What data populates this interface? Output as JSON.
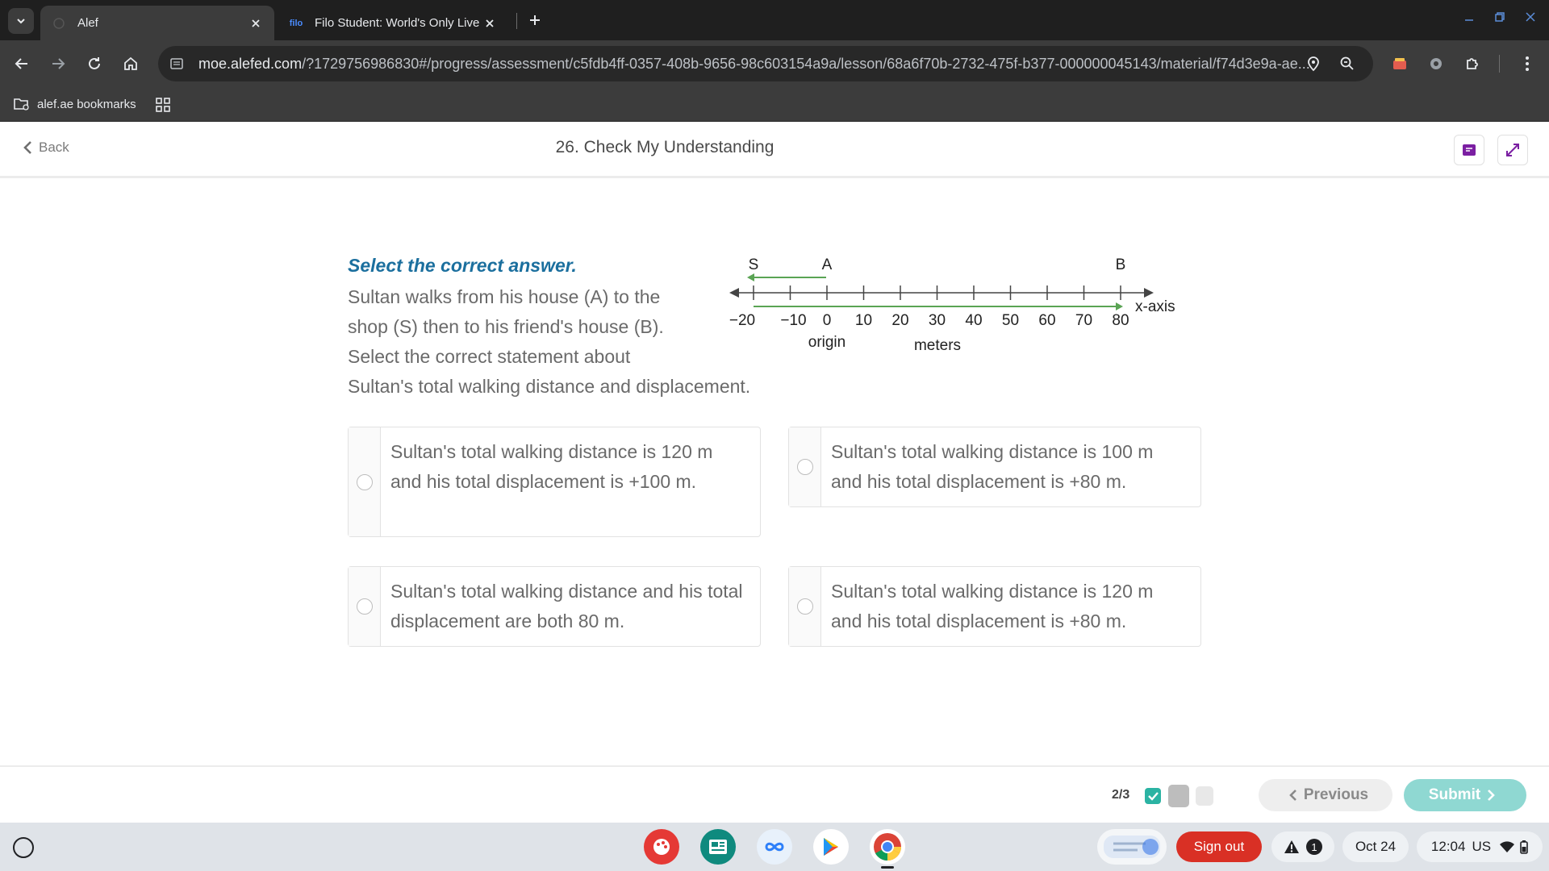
{
  "browser": {
    "tabs": [
      {
        "title": "Alef",
        "active": true
      },
      {
        "title": "Filo Student: World's Only Live I",
        "favicon_text": "filo",
        "active": false
      }
    ],
    "url_domain": "moe.alefed.com",
    "url_rest": "/?1729756986830#/progress/assessment/c5fdb4ff-0357-408b-9656-98c603154a9a/lesson/68a6f70b-2732-475f-b377-000000045143/material/f74d3e9a-ae...",
    "bookmark_label": "alef.ae bookmarks"
  },
  "header": {
    "back_label": "Back",
    "title": "26. Check My Understanding"
  },
  "question": {
    "prompt": "Select the correct answer.",
    "lines": [
      "Sultan walks from his house (A) to the",
      "shop (S) then to his friend's house (B).",
      "Select the correct statement about",
      "Sultan's total walking distance and displacement."
    ]
  },
  "diagram": {
    "point_labels": {
      "S": "S",
      "A": "A",
      "B": "B"
    },
    "ticks": [
      "−20",
      "−10",
      "0",
      "10",
      "20",
      "30",
      "40",
      "50",
      "60",
      "70",
      "80"
    ],
    "axis_label": "x-axis",
    "origin_label": "origin",
    "unit_label": "meters",
    "arrow_color": "#5aa454"
  },
  "options": [
    {
      "text": "Sultan's total walking distance is 120 m and his total displacement is +100 m."
    },
    {
      "text": "Sultan's total walking distance is 100 m and his total displacement is +80 m."
    },
    {
      "text": "Sultan's total walking distance and his total displacement are both 80 m."
    },
    {
      "text": "Sultan's total walking distance is 120 m and his total displacement is +80 m."
    }
  ],
  "footer": {
    "progress": "2/3",
    "previous_label": "Previous",
    "submit_label": "Submit"
  },
  "shelf": {
    "signout_label": "Sign out",
    "notification_count": "1",
    "date": "Oct 24",
    "time": "12:04",
    "locale": "US"
  },
  "colors": {
    "accent": "#1b6f9e",
    "submit": "#8fd8d2",
    "signout": "#d93025",
    "check": "#2bb3a3"
  }
}
